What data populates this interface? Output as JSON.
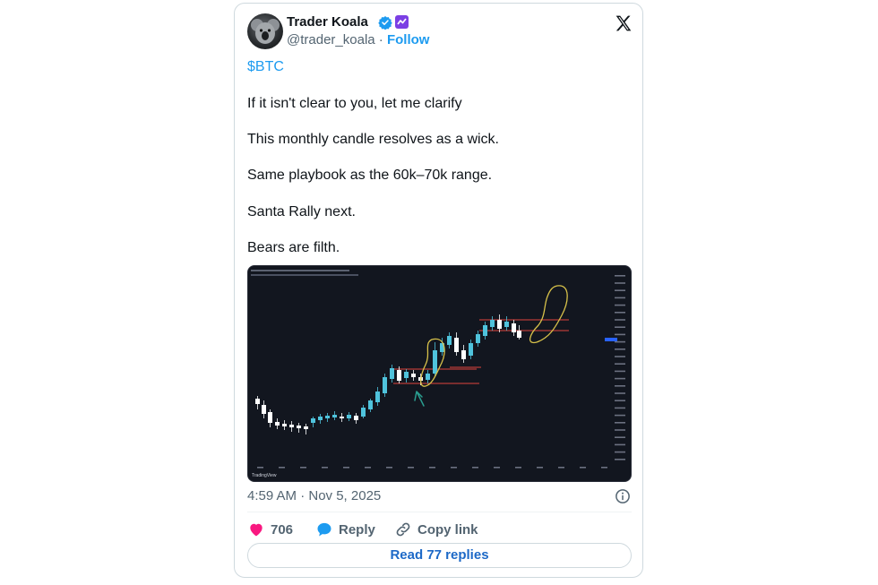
{
  "author": {
    "name": "Trader Koala",
    "handle": "@trader_koala",
    "separator": " · ",
    "follow_label": "Follow"
  },
  "tweet": {
    "cashtag": "$BTC",
    "lines": [
      "If it isn't clear to you, let me clarify",
      "This monthly candle resolves as a wick.",
      "Same playbook as the 60k–70k range.",
      "Santa Rally next.",
      "Bears are filth."
    ],
    "timestamp": "4:59 AM · Nov 5, 2025"
  },
  "chart_image": {
    "watermark": "TradingView",
    "interval": "Monthly"
  },
  "actions": {
    "likes": "706",
    "reply_label": "Reply",
    "copy_label": "Copy link",
    "read_replies_label": "Read 77 replies"
  },
  "colors": {
    "link_blue": "#1d9bf0",
    "like_pink": "#f91880",
    "chart_bg": "#12161f",
    "candle_up": "#4fc3dc",
    "candle_down": "#ffffff",
    "level_red": "#e0443c",
    "annotation_yellow": "#d8c24a",
    "arrow_teal": "#2a9d8f"
  },
  "icons": [
    "verified-badge-icon",
    "affiliate-badge-icon",
    "x-logo-icon",
    "info-icon",
    "heart-icon",
    "reply-bubble-icon",
    "link-icon"
  ]
}
